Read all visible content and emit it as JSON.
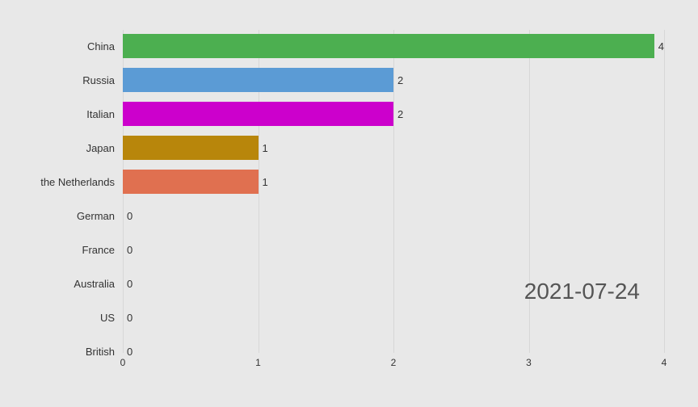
{
  "chart": {
    "date": "2021-07-24",
    "bars": [
      {
        "label": "China",
        "value": 4,
        "color": "#4caf50",
        "pct": 100
      },
      {
        "label": "Russia",
        "value": 2,
        "color": "#5b9bd5",
        "pct": 50
      },
      {
        "label": "Italian",
        "value": 2,
        "color": "#cc00cc",
        "pct": 50
      },
      {
        "label": "Japan",
        "value": 1,
        "color": "#b8860b",
        "pct": 25
      },
      {
        "label": "the Netherlands",
        "value": 1,
        "color": "#e07050",
        "pct": 25
      },
      {
        "label": "German",
        "value": 0,
        "color": "transparent",
        "pct": 0
      },
      {
        "label": "France",
        "value": 0,
        "color": "transparent",
        "pct": 0
      },
      {
        "label": "Australia",
        "value": 0,
        "color": "transparent",
        "pct": 0
      },
      {
        "label": "US",
        "value": 0,
        "color": "transparent",
        "pct": 0
      },
      {
        "label": "British",
        "value": 0,
        "color": "transparent",
        "pct": 0
      }
    ],
    "xTicks": [
      {
        "label": "0",
        "pct": 0
      },
      {
        "label": "0",
        "pct": 0
      },
      {
        "label": "1",
        "pct": 25
      },
      {
        "label": "2",
        "pct": 50
      },
      {
        "label": "2",
        "pct": 50
      },
      {
        "label": "3",
        "pct": 75
      },
      {
        "label": "4",
        "pct": 100
      },
      {
        "label": "4",
        "pct": 100
      }
    ]
  }
}
